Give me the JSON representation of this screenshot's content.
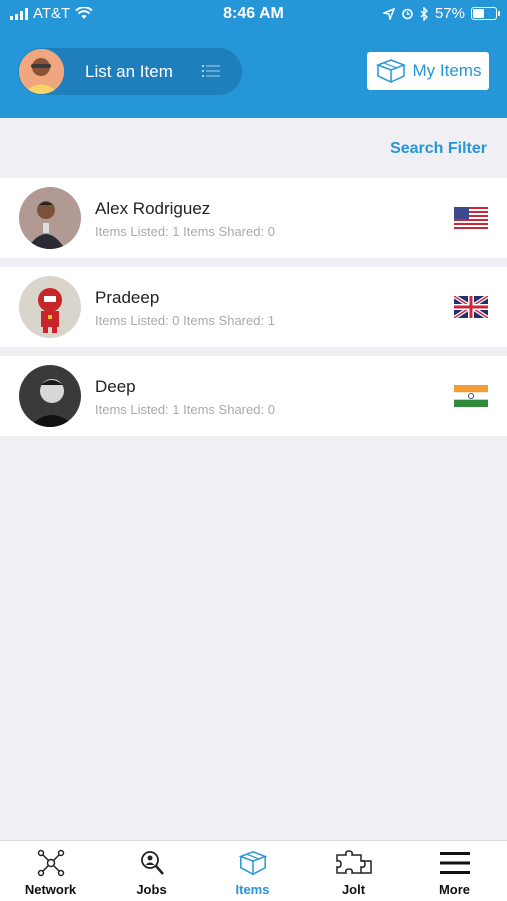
{
  "status_bar": {
    "carrier": "AT&T",
    "time": "8:46 AM",
    "battery": "57%",
    "battery_level": 0.57
  },
  "header": {
    "list_item_label": "List an Item",
    "my_items_label": "My Items"
  },
  "filter": {
    "label": "Search Filter"
  },
  "users": [
    {
      "name": "Alex Rodriguez",
      "stats": "Items Listed: 1 Items Shared: 0",
      "flag": "flag-us-icon"
    },
    {
      "name": "Pradeep",
      "stats": "Items Listed: 0 Items Shared: 1",
      "flag": "flag-uk-icon"
    },
    {
      "name": "Deep",
      "stats": "Items Listed: 1 Items Shared: 0",
      "flag": "flag-india-icon"
    }
  ],
  "tabs": [
    {
      "label": "Network",
      "icon": "network-icon"
    },
    {
      "label": "Jobs",
      "icon": "jobs-search-icon"
    },
    {
      "label": "Items",
      "icon": "items-box-icon",
      "active": true
    },
    {
      "label": "Jolt",
      "icon": "puzzle-icon"
    },
    {
      "label": "More",
      "icon": "hamburger-menu-icon"
    }
  ],
  "colors": {
    "accent": "#2596d8",
    "pill": "#1f7fbd",
    "background": "#efeff4"
  }
}
